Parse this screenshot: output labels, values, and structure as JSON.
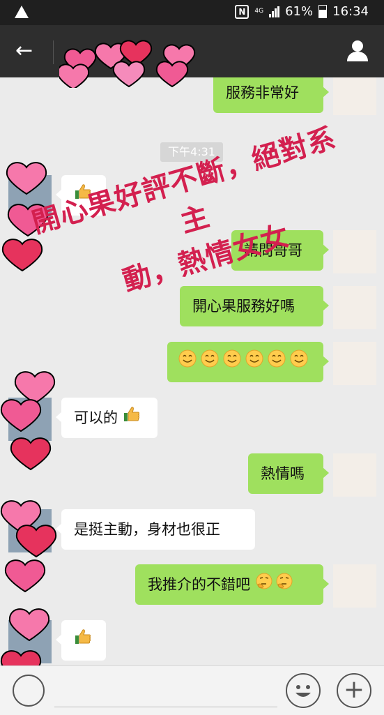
{
  "status_bar": {
    "battery": "61%",
    "time": "16:34",
    "network": "4G"
  },
  "header": {
    "title": ""
  },
  "timestamp": "下午4:31",
  "messages": [
    {
      "side": "out",
      "text": "服務非常好"
    },
    {
      "side": "in",
      "text": "",
      "emoji": "thumbs-up"
    },
    {
      "side": "out",
      "text": "請問哥哥"
    },
    {
      "side": "out",
      "text": "開心果服務好嗎"
    },
    {
      "side": "out",
      "text": "",
      "emoji": "smiling-face x6"
    },
    {
      "side": "in",
      "text": "可以的",
      "emoji": "thumbs-up"
    },
    {
      "side": "out",
      "text": "熱情嗎"
    },
    {
      "side": "in",
      "text": "是挺主動，身材也很正"
    },
    {
      "side": "out",
      "text": "我推介的不錯吧",
      "emoji": "thinking-face x2"
    },
    {
      "side": "in",
      "text": "",
      "emoji": "thumbs-up"
    }
  ],
  "overlay": {
    "line1": "開心果好評不斷，絕對系主",
    "line2": "動，熱情女女",
    "color": "#d3204f"
  },
  "colors": {
    "bubble_out": "#9fe05e",
    "bubble_in": "#ffffff",
    "header": "#2e2e2e",
    "chat_bg": "#ebebeb"
  },
  "icons": {
    "back": "arrow-left-icon",
    "profile": "person-icon",
    "emoji": "smiley-icon",
    "more": "plus-icon",
    "voice": "voice-icon"
  }
}
